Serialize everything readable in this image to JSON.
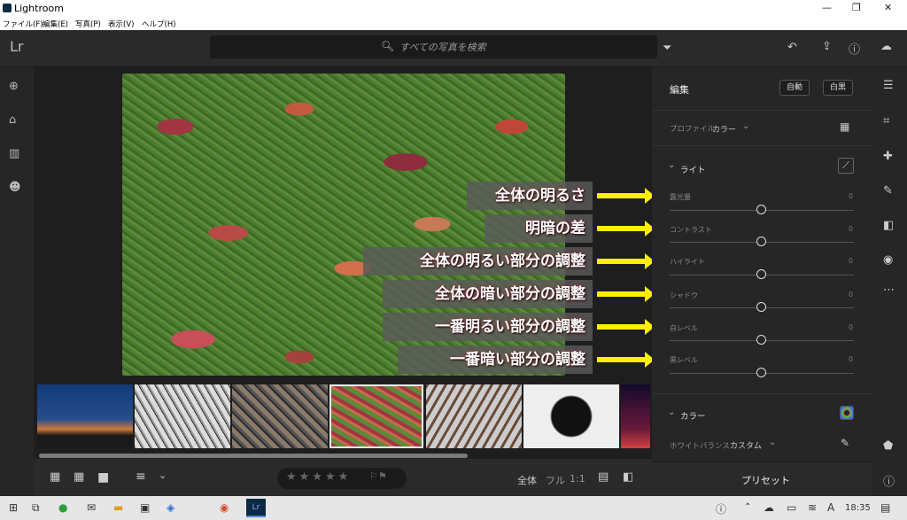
{
  "window": {
    "title": "Lightroom"
  },
  "menu": [
    "ファイル(F)",
    "編集(E)",
    "写真(P)",
    "表示(V)",
    "ヘルプ(H)"
  ],
  "search": {
    "placeholder": "すべての写真を検索"
  },
  "logo": "Lr",
  "annotations": [
    "全体の明るさ",
    "明暗の差",
    "全体の明るい部分の調整",
    "全体の暗い部分の調整",
    "一番明るい部分の調整",
    "一番暗い部分の調整"
  ],
  "panel": {
    "title": "編集",
    "auto_label": "自動",
    "bw_label": "白黒",
    "profile_label": "プロファイル",
    "profile_value": "カラー",
    "light_section": "ライト",
    "sliders": [
      {
        "label": "露光量",
        "value": "0"
      },
      {
        "label": "コントラスト",
        "value": "0"
      },
      {
        "label": "ハイライト",
        "value": "0"
      },
      {
        "label": "シャドウ",
        "value": "0"
      },
      {
        "label": "白レベル",
        "value": "0"
      },
      {
        "label": "黒レベル",
        "value": "0"
      }
    ],
    "color_section": "カラー",
    "wb_label": "ホワイトバランス",
    "wb_value": "カスタム",
    "preset_label": "プリセット"
  },
  "bottombar": {
    "view_all": "全体",
    "view_full": "フル",
    "view_1to1": "1:1"
  },
  "taskbar": {
    "clock": "18:35",
    "ime": "A"
  },
  "colors": {
    "accent": "#ffef00",
    "panel_bg": "#262626",
    "annotation_text": "#ffffff"
  }
}
